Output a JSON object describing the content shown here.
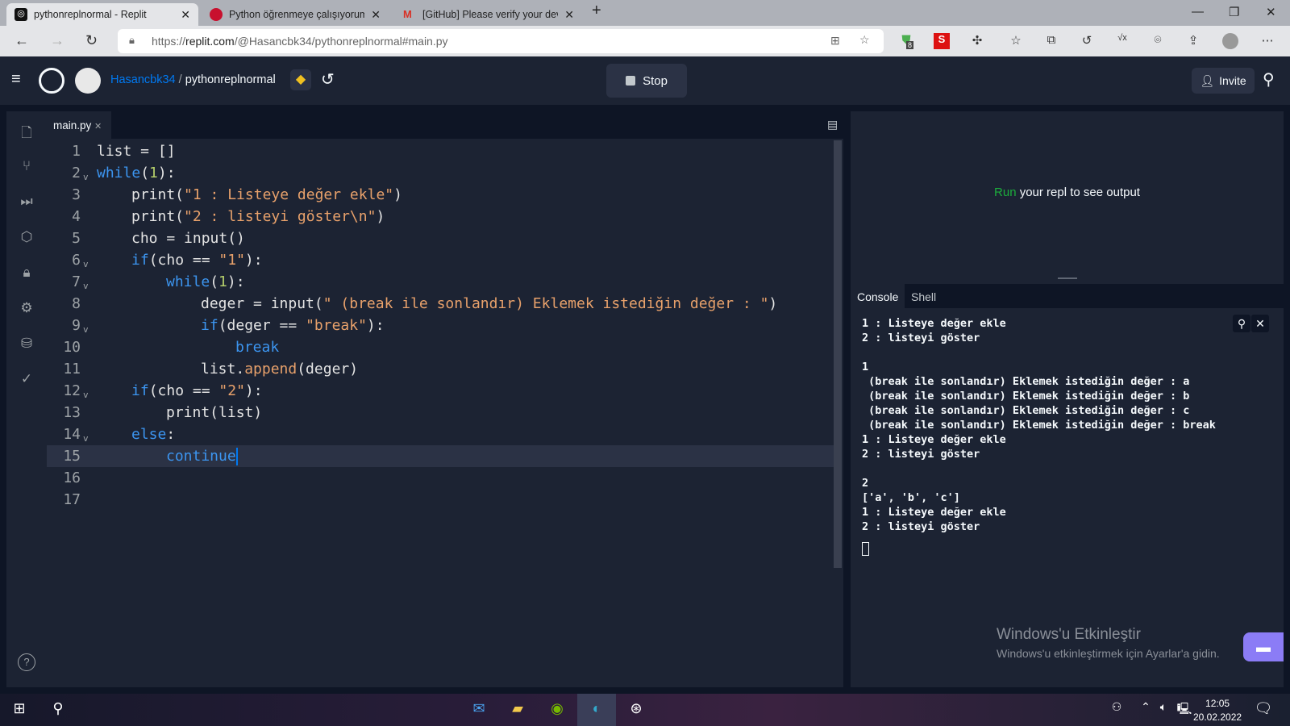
{
  "browser": {
    "tabs": [
      {
        "title": "pythonreplnormal - Replit",
        "active": true,
        "icon": "replit-icon"
      },
      {
        "title": "Python öğrenmeye çalışıyorum y",
        "active": false,
        "icon": "stackoverflow-tr-icon"
      },
      {
        "title": "[GitHub] Please verify your devic",
        "active": false,
        "icon": "gmail-icon"
      }
    ],
    "new_tab": "+",
    "url_prefix": "https://",
    "url_host": "replit.com",
    "url_path": "/@Hasancbk34/pythonreplnormal#main.py",
    "extension_badge": "8"
  },
  "header": {
    "user": "Hasancbk34",
    "separator": "/",
    "repl": "pythonreplnormal",
    "stop_label": "Stop",
    "invite_label": "Invite"
  },
  "editor": {
    "tab": "main.py",
    "current_line": 15,
    "lines": [
      {
        "n": "1",
        "fold": false,
        "indent": 0,
        "tokens": [
          [
            "list = []",
            ""
          ]
        ]
      },
      {
        "n": "2",
        "fold": true,
        "indent": 0,
        "tokens": [
          [
            "while",
            "kw"
          ],
          [
            "(",
            ""
          ],
          [
            "1",
            "num"
          ],
          [
            "):",
            ""
          ]
        ]
      },
      {
        "n": "3",
        "fold": false,
        "indent": 1,
        "tokens": [
          [
            "print(",
            ""
          ],
          [
            "\"1 : Listeye değer ekle\"",
            "str"
          ],
          [
            ")",
            ""
          ]
        ]
      },
      {
        "n": "4",
        "fold": false,
        "indent": 1,
        "tokens": [
          [
            "print(",
            ""
          ],
          [
            "\"2 : listeyi göster\\n\"",
            "str"
          ],
          [
            ")",
            ""
          ]
        ]
      },
      {
        "n": "5",
        "fold": false,
        "indent": 1,
        "tokens": [
          [
            "cho = input()",
            ""
          ]
        ]
      },
      {
        "n": "6",
        "fold": true,
        "indent": 1,
        "tokens": [
          [
            "if",
            "kw"
          ],
          [
            "(cho == ",
            ""
          ],
          [
            "\"1\"",
            "str"
          ],
          [
            "):",
            ""
          ]
        ]
      },
      {
        "n": "7",
        "fold": true,
        "indent": 2,
        "tokens": [
          [
            "while",
            "kw"
          ],
          [
            "(",
            ""
          ],
          [
            "1",
            "num"
          ],
          [
            "):",
            ""
          ]
        ]
      },
      {
        "n": "8",
        "fold": false,
        "indent": 3,
        "tokens": [
          [
            "deger = input(",
            ""
          ],
          [
            "\" (break ile sonlandır) Eklemek istediğin değer : \"",
            "str"
          ],
          [
            ")",
            ""
          ]
        ]
      },
      {
        "n": "9",
        "fold": true,
        "indent": 3,
        "tokens": [
          [
            "if",
            "kw"
          ],
          [
            "(deger == ",
            ""
          ],
          [
            "\"break\"",
            "str"
          ],
          [
            "):",
            ""
          ]
        ]
      },
      {
        "n": "10",
        "fold": false,
        "indent": 4,
        "tokens": [
          [
            "break",
            "kw"
          ]
        ]
      },
      {
        "n": "11",
        "fold": false,
        "indent": 3,
        "tokens": [
          [
            "list.",
            ""
          ],
          [
            "append",
            "fn"
          ],
          [
            "(deger)",
            ""
          ]
        ]
      },
      {
        "n": "12",
        "fold": true,
        "indent": 1,
        "tokens": [
          [
            "if",
            "kw"
          ],
          [
            "(cho == ",
            ""
          ],
          [
            "\"2\"",
            "str"
          ],
          [
            "):",
            ""
          ]
        ]
      },
      {
        "n": "13",
        "fold": false,
        "indent": 2,
        "tokens": [
          [
            "print(list)",
            ""
          ]
        ]
      },
      {
        "n": "14",
        "fold": true,
        "indent": 1,
        "tokens": [
          [
            "else",
            "kw"
          ],
          [
            ":",
            ""
          ]
        ]
      },
      {
        "n": "15",
        "fold": false,
        "indent": 2,
        "tokens": [
          [
            "continue",
            "kw"
          ]
        ]
      },
      {
        "n": "16",
        "fold": false,
        "indent": 0,
        "tokens": []
      },
      {
        "n": "17",
        "fold": false,
        "indent": 0,
        "tokens": []
      }
    ]
  },
  "output": {
    "run_word": "Run",
    "rest": " your repl to see output"
  },
  "console": {
    "tabs": [
      "Console",
      "Shell"
    ],
    "lines": [
      "1 : Listeye değer ekle",
      "2 : listeyi göster",
      "",
      "1",
      " (break ile sonlandır) Eklemek istediğin değer : a",
      " (break ile sonlandır) Eklemek istediğin değer : b",
      " (break ile sonlandır) Eklemek istediğin değer : c",
      " (break ile sonlandır) Eklemek istediğin değer : break",
      "1 : Listeye değer ekle",
      "2 : listeyi göster",
      "",
      "2",
      "['a', 'b', 'c']",
      "1 : Listeye değer ekle",
      "2 : listeyi göster"
    ]
  },
  "watermark": {
    "title": "Windows'u Etkinleştir",
    "subtitle": "Windows'u etkinleştirmek için Ayarlar'a gidin."
  },
  "taskbar": {
    "time": "12:05",
    "date": "20.02.2022"
  },
  "colors": {
    "keyword": "#3c95f0",
    "string": "#e8a16b",
    "number": "#b5cf6b",
    "run": "#1cad3c",
    "user_link": "#0079f2",
    "chat": "#8b7cf6"
  }
}
